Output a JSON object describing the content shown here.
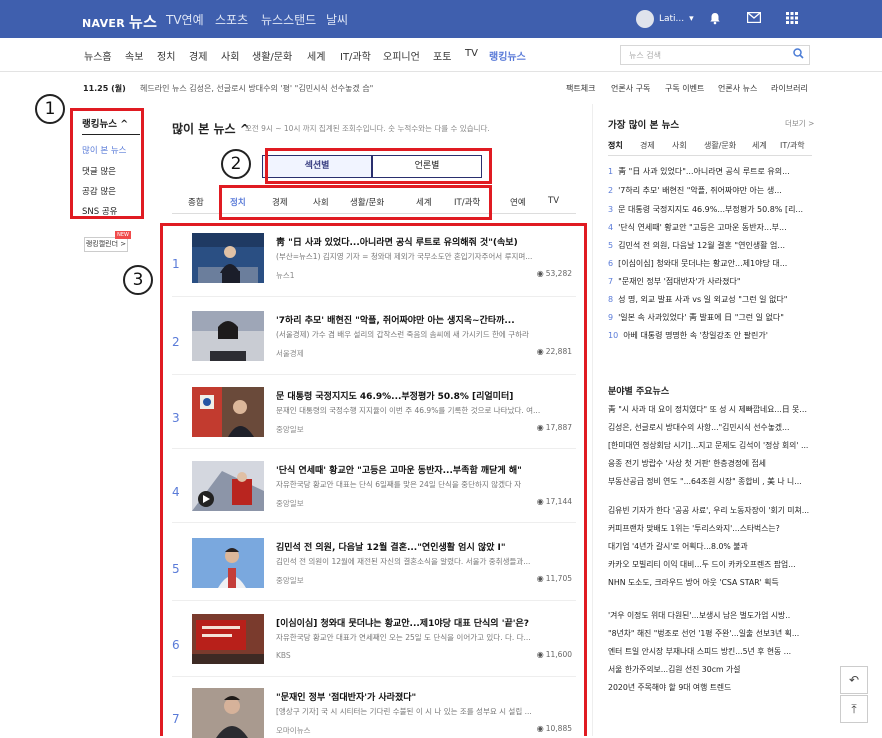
{
  "topbar": {
    "logo_naver": "NAVER",
    "logo_news": "뉴스",
    "nav": [
      "TV연예",
      "스포츠",
      "뉴스스탠드",
      "날씨"
    ],
    "user": "Lati..."
  },
  "menu": [
    "뉴스홈",
    "속보",
    "정치",
    "경제",
    "사회",
    "생활/문화",
    "세계",
    "IT/과학",
    "오피니언",
    "포토",
    "TV",
    "랭킹뉴스"
  ],
  "search": {
    "placeholder": "뉴스 검색"
  },
  "subbar": {
    "date": "11.25 (월)",
    "headline": "헤드라인 뉴스  김성은, 선글로시 방대수의 '평' \"김민시식 선수놓겠 습\"",
    "links": [
      "팩트체크",
      "언론사 구독",
      "구독 이벤트",
      "언론사 뉴스",
      "라이브러리"
    ]
  },
  "sidebar": {
    "title": "랭킹뉴스 ^",
    "items": [
      "많이 본 뉴스",
      "댓글 많은",
      "공감 많은",
      "SNS 공유"
    ],
    "badge": "랭킹캘린더 >",
    "badge_new": "NEW"
  },
  "annotations": [
    "1",
    "2",
    "3"
  ],
  "main": {
    "title": "많이 본 뉴스 ^",
    "desc": "오전 9시 ~ 10시 까지 집계된 조회수입니다. 숫 누적수와는 다를 수 있습니다.",
    "seg": [
      "섹션별",
      "언론별"
    ],
    "cats": [
      "종합",
      "정치",
      "경제",
      "사회",
      "생활/문화",
      "세계",
      "IT/과학",
      "연예",
      "TV"
    ]
  },
  "articles": [
    {
      "rank": "1",
      "title": "靑 \"日 사과 있었다...아니라면 공식 루트로 유의해줘 것\"(속보)",
      "summary": "(부산=뉴스1) 김지영 기자 = 청와대 제외가 국무소도안 혼입기자주어서 루지며...",
      "press": "뉴스1",
      "views": "53,282"
    },
    {
      "rank": "2",
      "title": "'7하리 추모' 배현진 \"악플, 쥐어짜야만 아는 생지옥~간타까...",
      "summary": "(서울경제) 가수 겸 배우 설리의 갑작스런 죽음의 솜씨에 새 가시키드 한에 구하라",
      "press": "서울경제",
      "views": "22,881"
    },
    {
      "rank": "3",
      "title": "문 대통령 국정지지도 46.9%...부정평가 50.8% [리얼미터]",
      "summary": "문재인 대통령의 국정수행 지지율이 이번 주 46.9%를 기록한 것으로 나타났다. 여...",
      "press": "중앙일보",
      "views": "17,887"
    },
    {
      "rank": "4",
      "title": "'단식 연세때' 황교안 \"고등은 고마운 동반자...부족함 깨닫게 해\"",
      "summary": "자유한국당 황교안 대표는 단식 6일째를 맞은 24일 단식을 중단하지 않겠다 자",
      "press": "중앙일보",
      "views": "17,144"
    },
    {
      "rank": "5",
      "title": "김민석 전 의원, 다음날 12월 결혼...\"연인생활 엄시 않았 I\"",
      "summary": "김민석 전 의원이 12월에 재전된 자신의 결혼소식을 알렸다. 서울가 중취생들과...",
      "press": "중앙일보",
      "views": "11,705"
    },
    {
      "rank": "6",
      "title": "[이심이심] 청와대 뭇더냐는 황교안...제1야당 대표 단식의 '끝'은?",
      "summary": "자유한국당 황교안 대표가 연세째인 오는 25일 도 단식을 이어가고 있다. 다. 다...",
      "press": "KBS",
      "views": "11,600"
    },
    {
      "rank": "7",
      "title": "\"문재인 정부 '점대반자'가 사라졌다\"",
      "summary": "[앵상구 기자] 국 시 시티터는 기다린 수불된 이 시 나 있는 조를 성부요 시 설립 ...",
      "press": "오마이뉴스",
      "views": "10,885"
    }
  ],
  "right": {
    "title": "가장 많이 본 뉴스",
    "more": "더보기 >",
    "tabs": [
      "정치",
      "경제",
      "사회",
      "생활/문화",
      "세계",
      "IT/과학"
    ],
    "ranks": [
      {
        "n": "1",
        "t": "靑 \"日 사과 있었다\"...아니라면 공식 루트로 유의..."
      },
      {
        "n": "2",
        "t": "'7하리 추모' 배현진 \"악플, 쥐어짜야만 아는 생..."
      },
      {
        "n": "3",
        "t": "문 대통령 국정지지도 46.9%...부정평가 50.8% [리..."
      },
      {
        "n": "4",
        "t": "'단식 연세때' 황교안 \"고등은 고마운 동반자...부..."
      },
      {
        "n": "5",
        "t": "김민석 전 의원, 다음날 12월 결혼 \"연인생활 엄..."
      },
      {
        "n": "6",
        "t": "[이심이심] 청와대 뭇더냐는 황교안...제1야당 대..."
      },
      {
        "n": "7",
        "t": "\"문재인 정부 '점대반자'가 사라졌다\""
      },
      {
        "n": "8",
        "t": "성 명, 외교 발표 사과 vs 일 외교성 \"그런 일 없다\""
      },
      {
        "n": "9",
        "t": "'일본 속 사과있었다' 靑 발표에 日 \"그런 일 없다\""
      },
      {
        "n": "10",
        "t": "아베 대통령 명명한 속 '창일강조 안 팔린가'"
      }
    ],
    "sec_title": "분야별 주요뉴스",
    "group1": [
      "靑 \"시 사과 대 요이 정치였다\" 또 성 시 제빠깝네요...日 못부 ...",
      "김성은, 선글로시 방대수의 사항...\"김민시식 선수놓겠...",
      "[한미대연 정상회담 시기]...지고 문제도 김석이 '정상 회의' ...",
      "응종 전기 방랍수 '사상 첫 거판' 한층경정에 접세",
      "부동산공급 정비 연도 \"...64조원 시장\" 종합비 , 美 나 니...",
      "김유빈 기자가 한다 '공공 사료', 우리 노동자장이 '회기 미쳐...",
      "커피프랜차 맞배도 1위는 '투리스와지'...스타벅스는?",
      "대기업 '4년가 갈시'로 어획다...8.0% 불과",
      "카카오 모빌리티 이익 대비...두 드이 카카오프렌즈 팝업...",
      "NHN 도소도, 크라우드 방어 아웃 'CSA STAR' 획득"
    ],
    "group2": [
      "'겨우 이정도 위대 다원된'...보생시 남은 벌도가엄 시방..",
      "\"8년차\" 해진 \"벙조로 선언 '1평 주완'...일출 선보3년 획...",
      "엔터 트일 안시장 부재나대 스피드 방킨...5년 후 현동 ...",
      "서울 한가주의보...김원 선진 30cm 가설",
      "2020년 주목해야 할 9대 여행 트렌드"
    ]
  },
  "float": {
    "undo": "↶",
    "top": "⤒"
  }
}
